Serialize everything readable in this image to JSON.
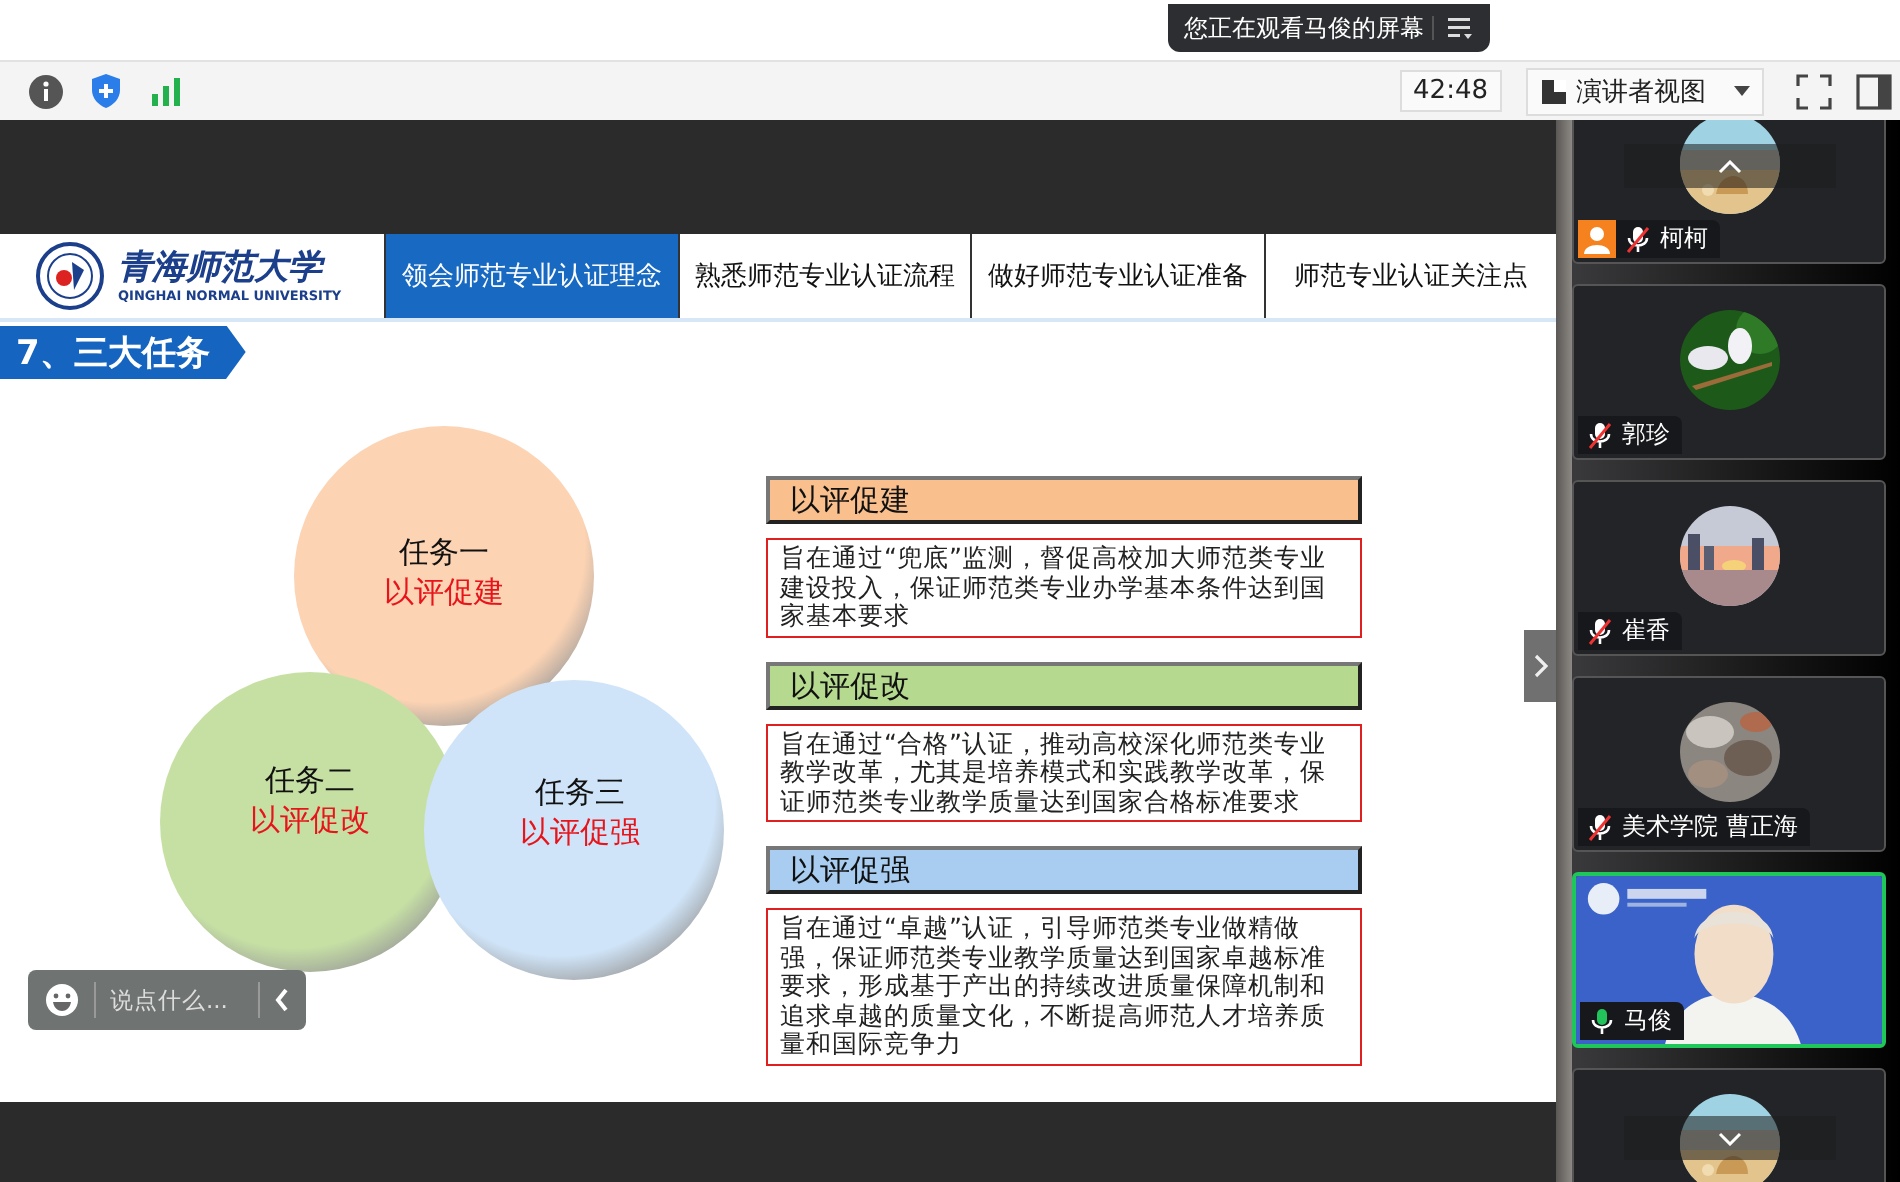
{
  "share_banner": {
    "text": "您正在观看马俊的屏幕"
  },
  "toolbar": {
    "timer": "42:48",
    "view_menu": "演讲者视图"
  },
  "slide": {
    "logo": {
      "name": "青海师范大学",
      "subtitle": "QINGHAI NORMAL UNIVERSITY"
    },
    "tabs": [
      {
        "label": "领会师范专业认证理念",
        "selected": true
      },
      {
        "label": "熟悉师范专业认证流程",
        "selected": false
      },
      {
        "label": "做好师范专业认证准备",
        "selected": false
      },
      {
        "label": "师范专业认证关注点",
        "selected": false
      }
    ],
    "title": "7、三大任务",
    "tasks": [
      {
        "label": "任务一",
        "motto": "以评促建",
        "color": "#fcd3b3"
      },
      {
        "label": "任务二",
        "motto": "以评促改",
        "color": "#c6e0a4"
      },
      {
        "label": "任务三",
        "motto": "以评促强",
        "color": "#cfe4f8"
      }
    ],
    "panels": [
      {
        "heading": "以评促建",
        "color": "#f9bf8d",
        "body": "旨在通过“兜底”监测，督促高校加大师范类专业建设投入，保证师范类专业办学基本条件达到国家基本要求"
      },
      {
        "heading": "以评促改",
        "color": "#b4d98f",
        "body": "旨在通过“合格”认证，推动高校深化师范类专业教学改革，尤其是培养模式和实践教学改革，保证师范类专业教学质量达到国家合格标准要求"
      },
      {
        "heading": "以评促强",
        "color": "#a9cdf1",
        "body": "旨在通过“卓越”认证，引导师范类专业做精做强，保证师范类专业教学质量达到国家卓越标准要求，形成基于产出的持续改进质量保障机制和追求卓越的质量文化，不断提高师范人才培养质量和国际竞争力"
      }
    ]
  },
  "chat": {
    "placeholder": "说点什么..."
  },
  "participants": [
    {
      "kind": "avatar",
      "name": "柯柯",
      "muted": true,
      "host_badge": true,
      "speaking": false
    },
    {
      "kind": "avatar",
      "name": "郭珍",
      "muted": true,
      "host_badge": false,
      "speaking": false
    },
    {
      "kind": "avatar",
      "name": "崔香",
      "muted": true,
      "host_badge": false,
      "speaking": false
    },
    {
      "kind": "avatar",
      "name": "美术学院 曹正海",
      "muted": true,
      "host_badge": false,
      "speaking": false
    },
    {
      "kind": "video",
      "name": "马俊",
      "muted": false,
      "host_badge": false,
      "speaking": true
    },
    {
      "kind": "avatar"
    }
  ]
}
